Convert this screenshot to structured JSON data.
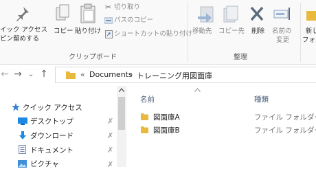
{
  "ribbon": {
    "clipboard": {
      "pin_label_line1": "イック アクセス",
      "pin_label_line2": "ピン留めする",
      "copy_label": "コピー",
      "paste_label": "貼り付け",
      "cut_label": "切り取り",
      "copy_path_label": "パスのコピー",
      "paste_shortcut_label": "ショートカットの貼り付け",
      "group_label": "クリップボード"
    },
    "organize": {
      "move_to_label": "移動先",
      "copy_to_label": "コピー先",
      "delete_label": "削除",
      "rename_line1": "名前の",
      "rename_line2": "変更",
      "group_label": "整理"
    },
    "new": {
      "new_folder_line1": "新し",
      "new_folder_line2": "フォル"
    }
  },
  "nav": {
    "back_glyph": "←",
    "forward_glyph": "→",
    "recent_glyph": "⌄",
    "up_glyph": "↑"
  },
  "address": {
    "overflow": "«",
    "segments": [
      "Documents",
      "トレーニング用図面庫"
    ],
    "separator": "›"
  },
  "navpane": {
    "items": [
      {
        "label": "クイック アクセス",
        "icon": "star-icon"
      },
      {
        "label": "デスクトップ",
        "icon": "desktop-icon"
      },
      {
        "label": "ダウンロード",
        "icon": "download-icon"
      },
      {
        "label": "ドキュメント",
        "icon": "document-icon"
      },
      {
        "label": "ピクチャ",
        "icon": "pictures-icon"
      }
    ]
  },
  "content": {
    "columns": {
      "name": "名前",
      "type": "種類"
    },
    "rows": [
      {
        "name": "図面庫A",
        "type": "ファイル フォルダー"
      },
      {
        "name": "図面庫B",
        "type": "ファイル フォルダー"
      }
    ]
  },
  "colors": {
    "folder": "#e8b93c",
    "accent": "#1e7fd6",
    "pin_blue": "#4a7bc0"
  }
}
